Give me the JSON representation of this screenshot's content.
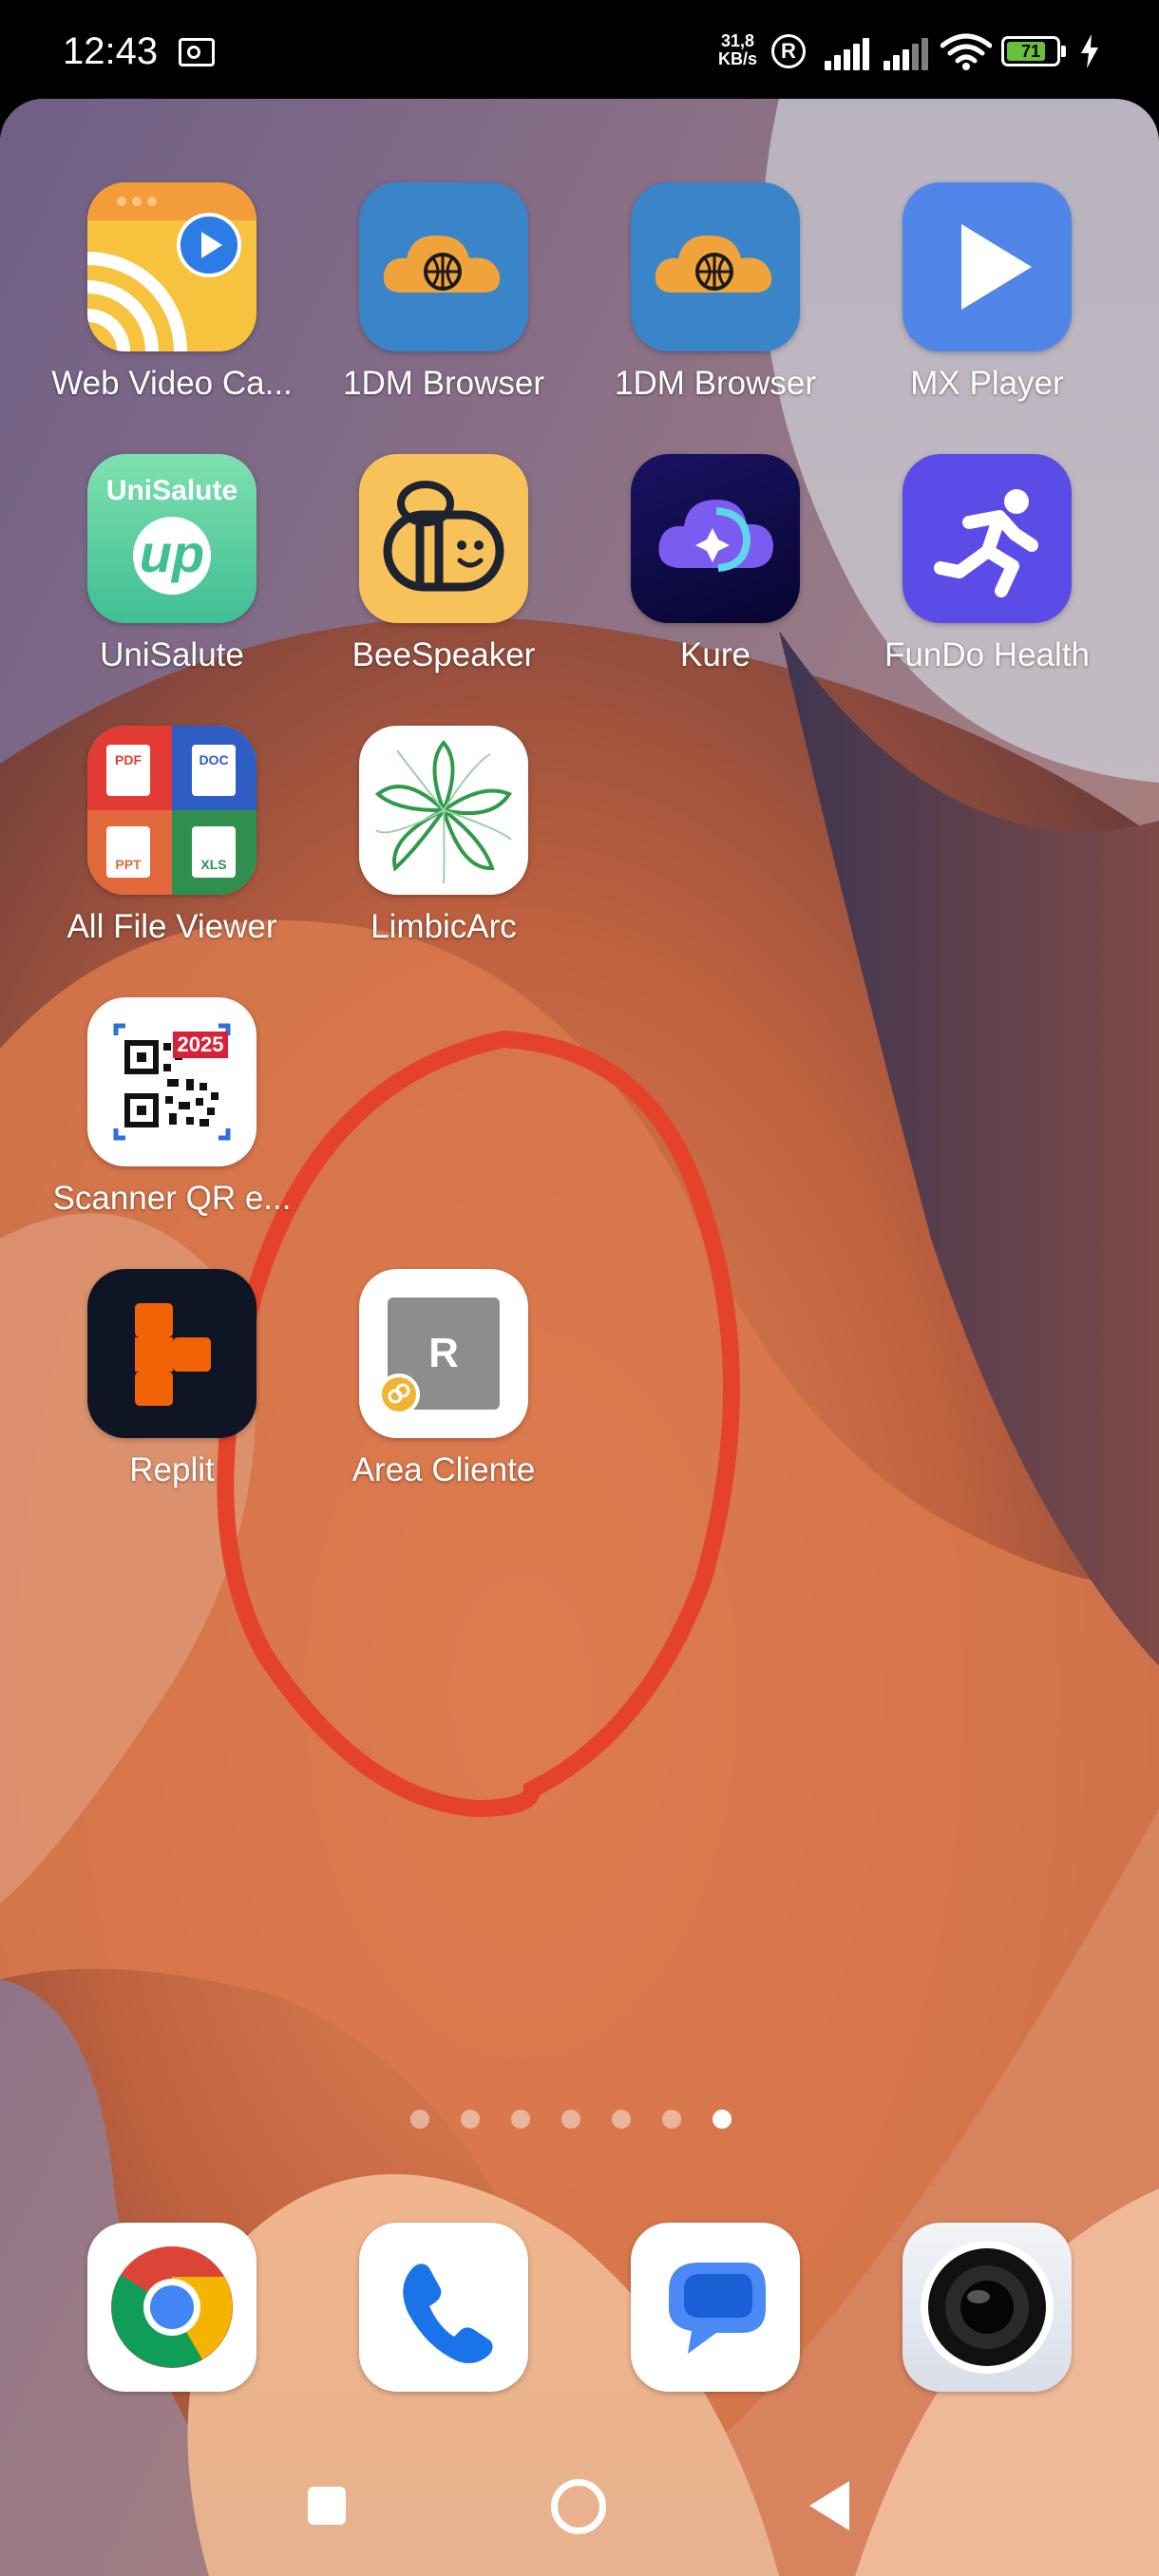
{
  "status_bar": {
    "time": "12:43",
    "net_speed_value": "31,8",
    "net_speed_unit": "KB/s",
    "battery_level": "71"
  },
  "apps": [
    {
      "label": "Web Video Ca..."
    },
    {
      "label": "1DM Browser"
    },
    {
      "label": "1DM Browser"
    },
    {
      "label": "MX Player"
    },
    {
      "label": "UniSalute",
      "icon_text_top": "UniSalute",
      "icon_text_main": "up"
    },
    {
      "label": "BeeSpeaker"
    },
    {
      "label": "Kure"
    },
    {
      "label": "FunDo Health"
    },
    {
      "label": "All File Viewer",
      "tiles": [
        "PDF",
        "DOC",
        "PPT",
        "XLS"
      ]
    },
    {
      "label": "LimbicArc"
    },
    {
      "label": "Scanner QR e...",
      "badge": "2025"
    },
    {
      "label": "Replit"
    },
    {
      "label": "Area Cliente",
      "icon_letter": "R"
    }
  ],
  "page_indicator": {
    "count": 7,
    "active_index": 6
  },
  "dock": [
    {
      "name": "chrome-icon"
    },
    {
      "name": "phone-icon"
    },
    {
      "name": "messages-icon"
    },
    {
      "name": "camera-icon"
    }
  ],
  "colors": {
    "annotation_circle": "#e5422b",
    "battery_fill": "#67c23a",
    "one_dm_blue": "#3a85c9",
    "mx_blue": "#4f86e8",
    "fundo_purple": "#5b4ce8"
  }
}
